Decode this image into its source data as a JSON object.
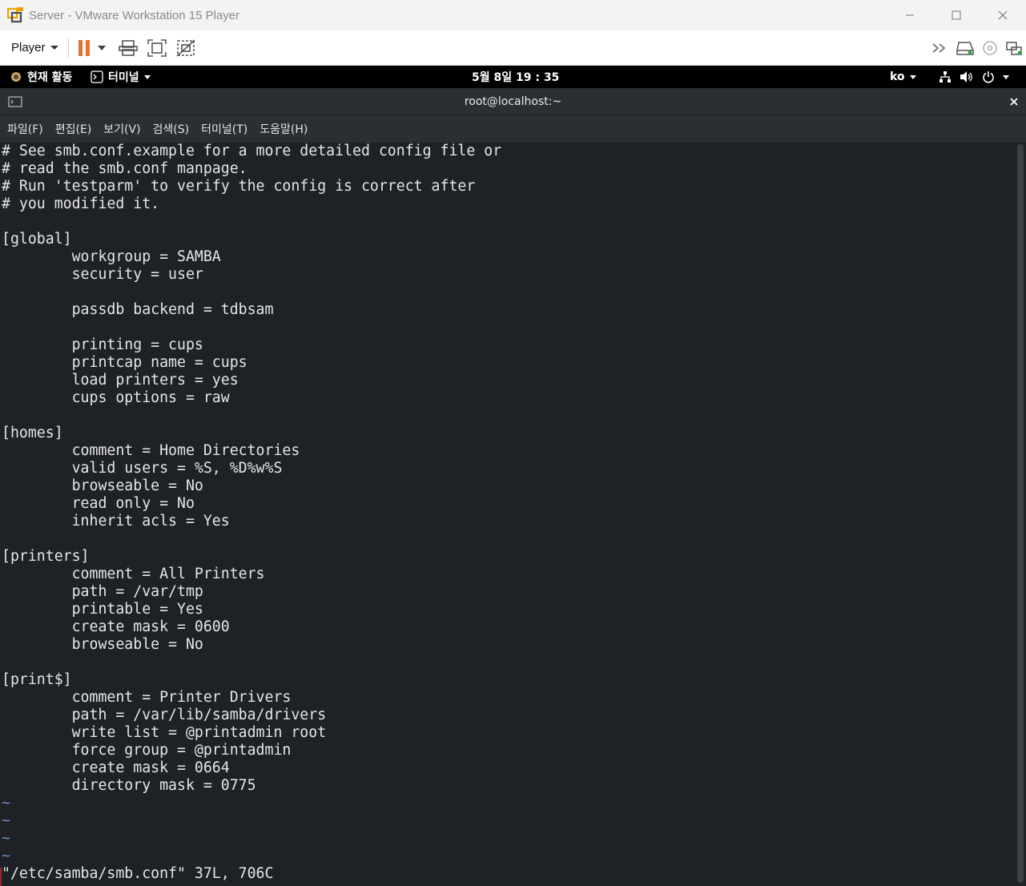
{
  "window": {
    "title": "Server - VMware Workstation 15 Player"
  },
  "toolbar": {
    "player_label": "Player"
  },
  "gnome": {
    "activities_label": "현재 활동",
    "app_label": "터미널",
    "clock": "5월 8일  19 : 35",
    "lang": "ko"
  },
  "terminal": {
    "title": "root@localhost:~",
    "menus": [
      "파일(F)",
      "편집(E)",
      "보기(V)",
      "검색(S)",
      "터미널(T)",
      "도움말(H)"
    ],
    "lines": [
      "# See smb.conf.example for a more detailed config file or",
      "# read the smb.conf manpage.",
      "# Run 'testparm' to verify the config is correct after",
      "# you modified it.",
      "",
      "[global]",
      "        workgroup = SAMBA",
      "        security = user",
      "",
      "        passdb backend = tdbsam",
      "",
      "        printing = cups",
      "        printcap name = cups",
      "        load printers = yes",
      "        cups options = raw",
      "",
      "[homes]",
      "        comment = Home Directories",
      "        valid users = %S, %D%w%S",
      "        browseable = No",
      "        read only = No",
      "        inherit acls = Yes",
      "",
      "[printers]",
      "        comment = All Printers",
      "        path = /var/tmp",
      "        printable = Yes",
      "        create mask = 0600",
      "        browseable = No",
      "",
      "[print$]",
      "        comment = Printer Drivers",
      "        path = /var/lib/samba/drivers",
      "        write list = @printadmin root",
      "        force group = @printadmin",
      "        create mask = 0664",
      "        directory mask = 0775",
      "~",
      "~",
      "~",
      "~"
    ],
    "status_line": "\"/etc/samba/smb.conf\" 37L, 706C"
  },
  "colors": {
    "terminal_bg": "#1e2126",
    "terminal_fg": "#e6e6e6",
    "tilde": "#6b8cc4",
    "pause_orange": "#e8702a"
  },
  "icons": [
    "vmware-logo-icon",
    "minimize-icon",
    "maximize-icon",
    "close-icon",
    "pause-icon",
    "dropdown-icon",
    "send-ctrl-alt-del-icon",
    "fullscreen-icon",
    "unity-icon",
    "forward-icon",
    "hdd-icon",
    "cd-icon",
    "network-icon",
    "activities-icon",
    "terminal-icon",
    "network-wired-icon",
    "volume-icon",
    "power-icon"
  ]
}
